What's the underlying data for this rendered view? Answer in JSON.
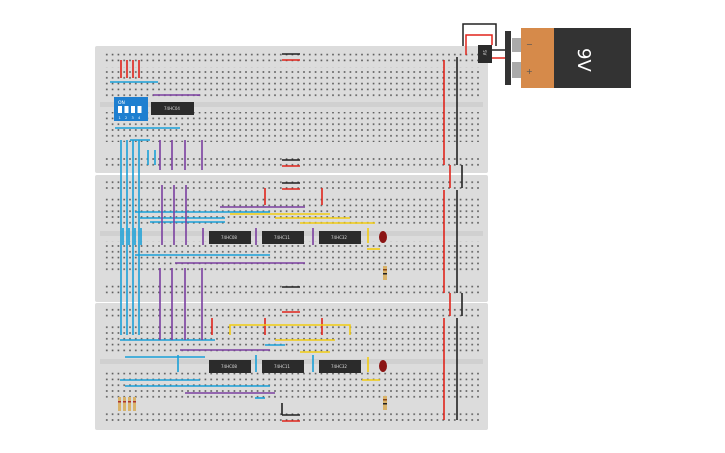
{
  "circuit": {
    "dip_switch": {
      "on_label": "ON",
      "positions": [
        "1",
        "2",
        "3",
        "4"
      ]
    },
    "board1_chips": [
      {
        "label": "74HC04"
      }
    ],
    "board2_chips": [
      {
        "label": "74HC08"
      },
      {
        "label": "74HC11"
      },
      {
        "label": "74HC32"
      }
    ],
    "board3_chips": [
      {
        "label": "74HC08"
      },
      {
        "label": "74HC11"
      },
      {
        "label": "74HC32"
      }
    ],
    "regulator": {
      "label": "5V"
    },
    "battery": {
      "label": "9V",
      "minus": "−",
      "plus": "+"
    },
    "colors": {
      "board": "#dcdcdc",
      "wire_blue": "#1aa0d8",
      "wire_purple": "#7b3fa0",
      "wire_yellow": "#f2cc12",
      "wire_red": "#e0241b",
      "wire_black": "#222222",
      "led": "#8b1414",
      "battery_orange": "#d68a4a",
      "battery_body": "#333333",
      "switch_blue": "#1e7fd0"
    }
  }
}
